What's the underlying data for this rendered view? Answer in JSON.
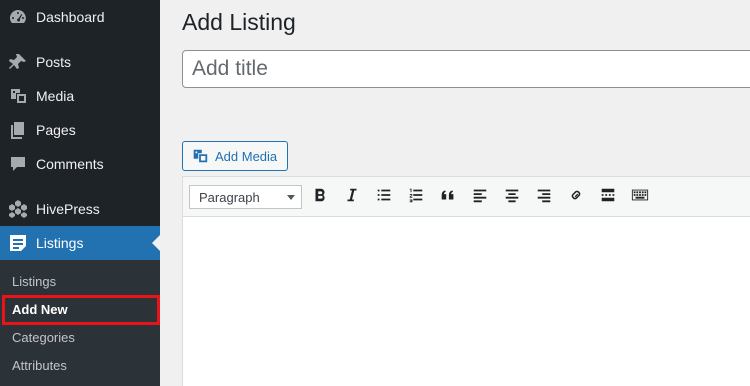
{
  "sidebar": {
    "items": [
      {
        "label": "Dashboard",
        "icon": "dashboard-icon"
      },
      {
        "label": "Posts",
        "icon": "pin-icon"
      },
      {
        "label": "Media",
        "icon": "media-icon"
      },
      {
        "label": "Pages",
        "icon": "pages-icon"
      },
      {
        "label": "Comments",
        "icon": "comment-icon"
      },
      {
        "label": "HivePress",
        "icon": "hivepress-icon"
      },
      {
        "label": "Listings",
        "icon": "listings-icon"
      }
    ],
    "submenu": [
      {
        "label": "Listings"
      },
      {
        "label": "Add New"
      },
      {
        "label": "Categories"
      },
      {
        "label": "Attributes"
      }
    ],
    "highlight_color": "#e8141a",
    "active_color": "#2271b1"
  },
  "main": {
    "title": "Add Listing",
    "title_placeholder": "Add title",
    "add_media_label": "Add Media",
    "format_select_value": "Paragraph",
    "toolbar_icons": [
      "bold-icon",
      "italic-icon",
      "bullet-list-icon",
      "numbered-list-icon",
      "blockquote-icon",
      "align-left-icon",
      "align-center-icon",
      "align-right-icon",
      "link-icon",
      "read-more-icon",
      "toolbar-toggle-icon"
    ]
  }
}
